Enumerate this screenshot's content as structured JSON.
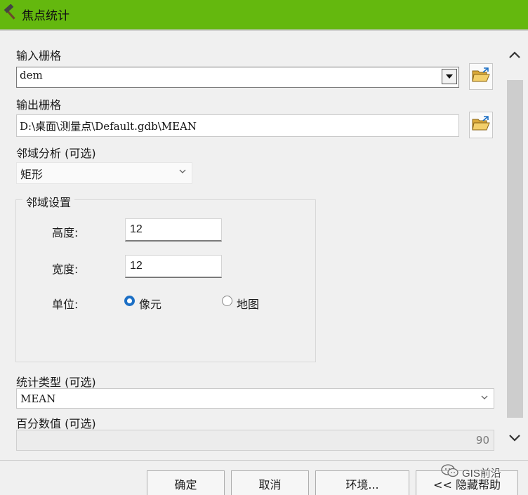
{
  "window": {
    "title": "焦点统计",
    "title_icon": "hammer-icon"
  },
  "input_raster": {
    "label": "输入栅格",
    "value": "dem",
    "browse_icon": "folder-open-icon"
  },
  "output_raster": {
    "label": "输出栅格",
    "value": "D:\\桌面\\测量点\\Default.gdb\\MEAN",
    "browse_icon": "folder-open-icon"
  },
  "neighborhood": {
    "label": "邻域分析 (可选)",
    "value": "矩形",
    "settings": {
      "title": "邻域设置",
      "height_label": "高度:",
      "height_value": "12",
      "width_label": "宽度:",
      "width_value": "12",
      "unit_label": "单位:",
      "unit_options": [
        {
          "label": "像元",
          "selected": true
        },
        {
          "label": "地图",
          "selected": false
        }
      ]
    }
  },
  "statistics_type": {
    "label": "统计类型 (可选)",
    "value": "MEAN"
  },
  "percentile": {
    "label": "百分数值 (可选)",
    "value": "90"
  },
  "buttons": {
    "ok": "确定",
    "cancel": "取消",
    "environments": "环境...",
    "hide_help": "<< 隐藏帮助"
  },
  "watermark": {
    "text": "GIS前沿",
    "icon": "wechat-icon"
  },
  "colors": {
    "title_bar": "#64b80e",
    "radio_accent": "#1c6fc5"
  }
}
